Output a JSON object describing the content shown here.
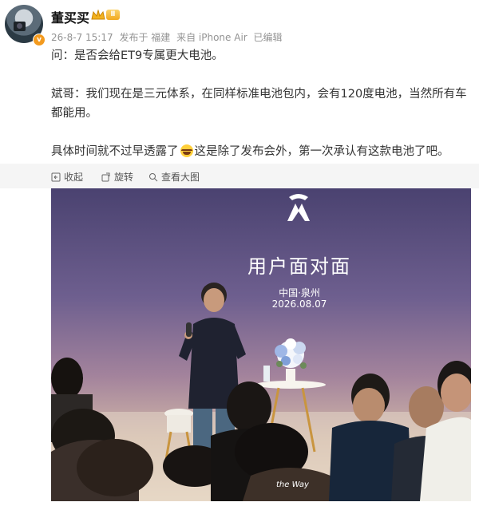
{
  "post": {
    "username": "董买买",
    "level_badge": "Ⅱ",
    "verified_badge": "v",
    "meta": {
      "time": "26-8-7 15:17",
      "published_in": "发布于 福建",
      "source": "来自 iPhone Air",
      "edited": "已编辑"
    },
    "paragraphs": [
      "问：是否会给ET9专属更大电池。",
      "斌哥：我们现在是三元体系，在同样标准电池包内，会有120度电池，当然所有车都能用。",
      "具体时间就不过早透露了",
      "这是除了发布会外，第一次承认有这款电池了吧。"
    ],
    "emoji": "grinning-sweat-emoji"
  },
  "toolbar": {
    "collapse": "收起",
    "rotate": "旋转",
    "view_large": "查看大图"
  },
  "photo": {
    "event_title": "用户面对面",
    "event_place": "中国·泉州",
    "event_date": "2026.08.07",
    "mug_text": "the Way"
  },
  "colors": {
    "accent_orange": "#f39a1e",
    "meta_gray": "#939393",
    "toolbar_bg": "#f5f5f5"
  }
}
